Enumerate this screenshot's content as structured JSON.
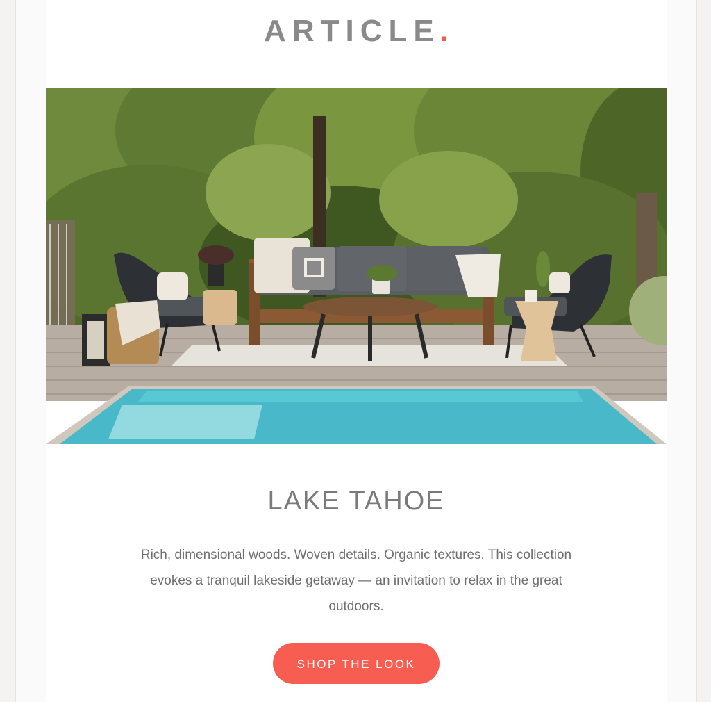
{
  "header": {
    "logo_text": "ARTICLE",
    "logo_dot": ".",
    "accent_color": "#f4594a"
  },
  "hero": {
    "image_label": "outdoor-patio-pool-photo"
  },
  "content": {
    "title": "LAKE TAHOE",
    "description": "Rich, dimensional woods. Woven details. Organic textures. This collection evokes a tranquil lakeside getaway — an invitation to relax in the great outdoors.",
    "cta_label": "SHOP THE LOOK",
    "cta_color": "#f75e51"
  }
}
